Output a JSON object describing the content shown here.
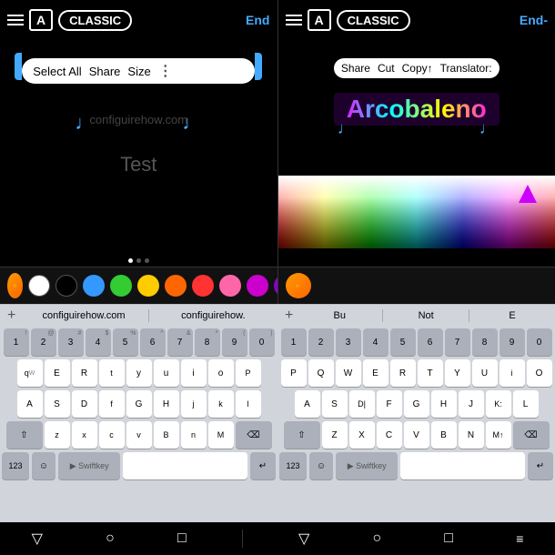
{
  "panels": {
    "left": {
      "topbar": {
        "font_label": "A",
        "mode_label": "CLASSIC",
        "end_label": "End"
      },
      "selection_bar": {
        "options": [
          "Select All",
          "Share",
          "Size"
        ],
        "more": "⋮"
      },
      "watermark": "configuirehow.com",
      "edit_text": "Test",
      "palette": {
        "eyedropper": "💧",
        "colors": [
          {
            "name": "white",
            "hex": "#ffffff",
            "selected": false
          },
          {
            "name": "black",
            "hex": "#000000",
            "selected": false
          },
          {
            "name": "blue",
            "hex": "#3399ff",
            "selected": false
          },
          {
            "name": "green",
            "hex": "#33cc33",
            "selected": false
          },
          {
            "name": "yellow",
            "hex": "#ffcc00",
            "selected": false
          },
          {
            "name": "orange",
            "hex": "#ff6600",
            "selected": false
          },
          {
            "name": "red",
            "hex": "#ff3333",
            "selected": false
          },
          {
            "name": "pink",
            "hex": "#ff66aa",
            "selected": false
          },
          {
            "name": "magenta",
            "hex": "#cc00cc",
            "selected": false
          },
          {
            "name": "purple",
            "hex": "#8800cc",
            "selected": false
          }
        ]
      }
    },
    "right": {
      "topbar": {
        "font_label": "A",
        "mode_label": "CLASSIC",
        "end_label": "End-"
      },
      "selection_bar": {
        "options": [
          "Share",
          "Cut",
          "Copy↑",
          "Translator:"
        ]
      },
      "highlighted_text": "Arcobaleno",
      "palette": {
        "eyedropper": "💧"
      }
    }
  },
  "keyboard": {
    "suggestions_left": [
      "configuirehow.com",
      "configuirehow."
    ],
    "suggestions_right": [
      "Bu",
      "Not",
      "E"
    ],
    "add_label": "+",
    "rows": [
      [
        "1",
        "2",
        "3",
        "4",
        "5",
        "6",
        "7",
        "8",
        "9",
        "0"
      ],
      [
        "q",
        "W",
        "E",
        "R",
        "t",
        "y",
        "u",
        "i",
        "o",
        "P"
      ],
      [
        "A",
        "S",
        "D",
        "f",
        "G",
        "H",
        "j",
        "k",
        "l"
      ],
      [
        "z",
        "x",
        "c",
        "v",
        "B",
        "n",
        "M"
      ]
    ],
    "rows_right": [
      [
        "1",
        "2",
        "3",
        "4",
        "5",
        "6",
        "7",
        "8",
        "9",
        "0"
      ],
      [
        "P",
        "Q",
        "W",
        "E",
        "R",
        "T",
        "Y",
        "U",
        "i",
        "O",
        "P"
      ],
      [
        "A",
        "S",
        "D|",
        "F",
        "G",
        "H",
        "J",
        "K:",
        "L"
      ],
      [
        "Z",
        "X",
        "C",
        "V",
        "B",
        "N",
        "M↑"
      ]
    ],
    "special": {
      "shift": "⇧",
      "backspace": "⌫",
      "numbers": "123",
      "emoji": "☺",
      "swiftkey": "Swiftkey",
      "space": "",
      "enter": "↵"
    }
  },
  "bottom_nav": {
    "items": [
      "▽",
      "○",
      "□",
      "≡",
      "▽",
      "○",
      "□",
      "="
    ]
  }
}
